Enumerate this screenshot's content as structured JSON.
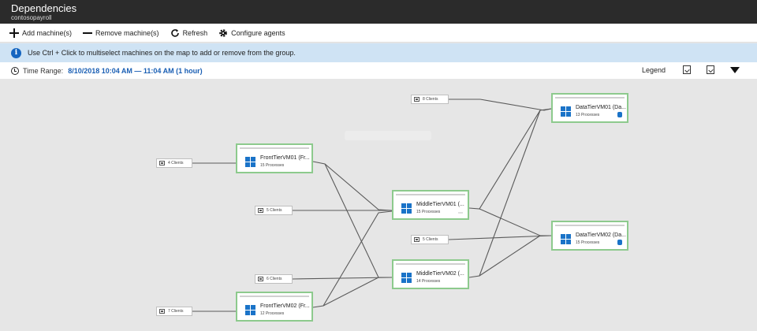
{
  "header": {
    "title": "Dependencies",
    "subtitle": "contosopayroll"
  },
  "toolbar": {
    "add_label": "Add machine(s)",
    "remove_label": "Remove machine(s)",
    "refresh_label": "Refresh",
    "configure_label": "Configure agents"
  },
  "info": {
    "text": "Use Ctrl + Click to multiselect machines on the map to add or remove from the group."
  },
  "time_range": {
    "label": "Time Range:",
    "value": "8/10/2018 10:04 AM — 11:04 AM (1 hour)"
  },
  "legend_label": "Legend",
  "clients": [
    {
      "label": "4 Clients"
    },
    {
      "label": "5 Clients"
    },
    {
      "label": "6 Clients"
    },
    {
      "label": "7 Clients"
    },
    {
      "label": "8 Clients"
    },
    {
      "label": "5 Clients"
    }
  ],
  "machines": [
    {
      "name": "FrontTierVM01 (Fr...",
      "processes": "15 Processes"
    },
    {
      "name": "FrontTierVM02 (Fr...",
      "processes": "12 Processes"
    },
    {
      "name": "MiddleTierVM01 (...",
      "processes": "15 Processes"
    },
    {
      "name": "MiddleTierVM02 (...",
      "processes": "14 Processes"
    },
    {
      "name": "DataTierVM01 (Da...",
      "processes": "13 Processes"
    },
    {
      "name": "DataTierVM02 (Da...",
      "processes": "15 Processes"
    }
  ],
  "colors": {
    "accent": "#1a5fb4",
    "machine_border": "#8dca8d",
    "header_bg": "#2b2b2b",
    "info_bg": "#cfe3f4"
  }
}
